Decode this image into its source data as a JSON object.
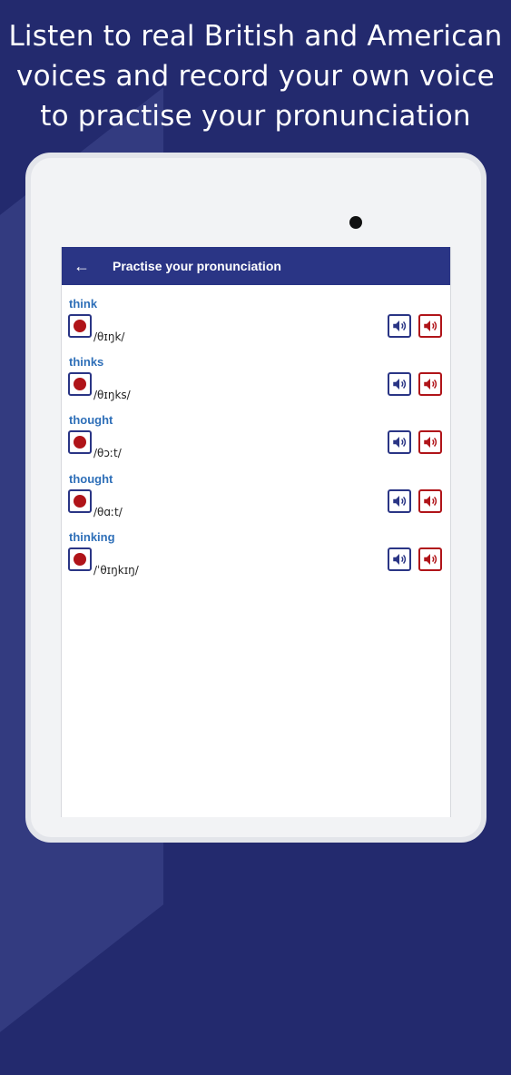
{
  "headline": {
    "line1": "Listen to real British and American",
    "line2": "voices and record your own voice",
    "line3": "to practise your pronunciation"
  },
  "appbar": {
    "back_icon": "arrow-left-icon",
    "title": "Practise your pronunciation"
  },
  "icons": {
    "record": "record-icon",
    "british_audio": "speaker-icon",
    "american_audio": "speaker-icon"
  },
  "colors": {
    "brand": "#2a3585",
    "background": "#232a6e",
    "word": "#2e6fb8",
    "record": "#b01419"
  },
  "words": [
    {
      "word": "think",
      "ipa": "/θɪŋk/"
    },
    {
      "word": "thinks",
      "ipa": "/θɪŋks/"
    },
    {
      "word": "thought",
      "ipa": "/θɔːt/"
    },
    {
      "word": "thought",
      "ipa": "/θɑːt/"
    },
    {
      "word": "thinking",
      "ipa": "/ˈθɪŋkɪŋ/"
    }
  ]
}
